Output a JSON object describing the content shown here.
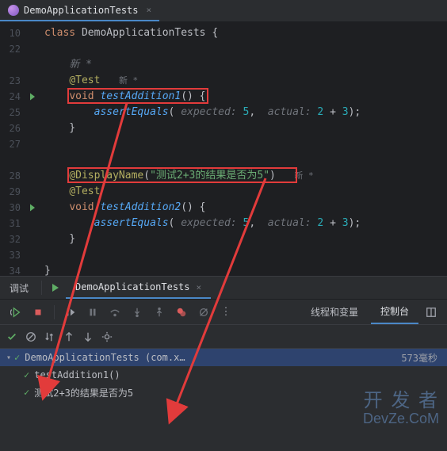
{
  "editor": {
    "tab": {
      "name": "DemoApplicationTests",
      "closable": true
    },
    "lines": [
      {
        "num": "10",
        "run": false,
        "html": "<span class='kw'>class</span> <span class='cls'>DemoApplicationTests</span> {"
      },
      {
        "num": "22",
        "run": false,
        "html": ""
      },
      {
        "num": "",
        "run": false,
        "html": "    <span class='hint'>新 *</span>"
      },
      {
        "num": "23",
        "run": false,
        "html": "    <span class='anno'>@Test</span>   <span class='new-badge'>新 *</span>"
      },
      {
        "num": "24",
        "run": true,
        "html": "    <span class='kw'>void</span> <span class='fn'>testAddition1</span>() {"
      },
      {
        "num": "25",
        "run": false,
        "html": "        <span class='fn'>assertEquals</span>( <span class='hint'>expected:</span> <span class='num'>5</span>,  <span class='hint'>actual:</span> <span class='num'>2</span> + <span class='num'>3</span>);"
      },
      {
        "num": "26",
        "run": false,
        "html": "    }"
      },
      {
        "num": "27",
        "run": false,
        "html": ""
      },
      {
        "num": "",
        "run": false,
        "html": ""
      },
      {
        "num": "28",
        "run": false,
        "html": "    <span class='anno'>@DisplayName</span>(<span class='str'>\"测试2+3的结果是否为5\"</span>)   <span class='new-badge'>新 *</span>"
      },
      {
        "num": "29",
        "run": false,
        "html": "    <span class='anno'>@Test</span>"
      },
      {
        "num": "30",
        "run": true,
        "html": "    <span class='kw'>void</span> <span class='fn'>testAddition2</span>() {"
      },
      {
        "num": "31",
        "run": false,
        "html": "        <span class='fn'>assertEquals</span>( <span class='hint'>expected:</span> <span class='num'>5</span>,  <span class='hint'>actual:</span> <span class='num'>2</span> + <span class='num'>3</span>);"
      },
      {
        "num": "32",
        "run": false,
        "html": "    }"
      },
      {
        "num": "33",
        "run": false,
        "html": ""
      },
      {
        "num": "34",
        "run": false,
        "html": "}"
      }
    ]
  },
  "panel": {
    "tabs": {
      "debug": "调试",
      "run": "DemoApplicationTests"
    },
    "rightTabs": {
      "threads": "线程和变量",
      "console": "控制台"
    }
  },
  "results": {
    "root": {
      "name": "DemoApplicationTests (com.x…",
      "time": "573毫秒"
    },
    "items": [
      {
        "name": "testAddition1()"
      },
      {
        "name": "测试2+3的结果是否为5"
      }
    ]
  },
  "watermark": {
    "l1": "开 发 者",
    "l2": "DevZe.CoM"
  }
}
